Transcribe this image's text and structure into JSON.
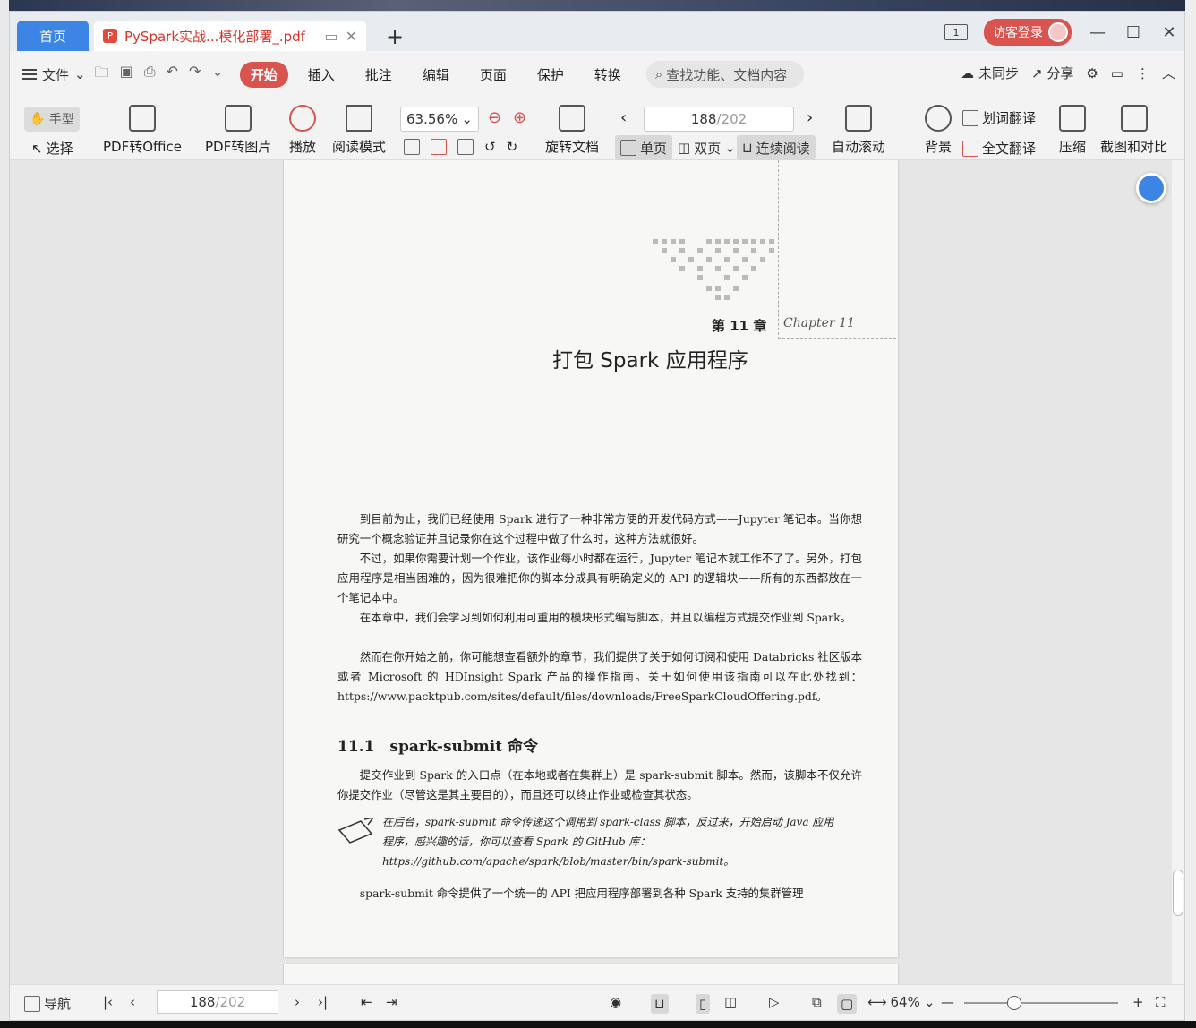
{
  "tabs": {
    "home": "首页",
    "doc": "PySpark实战...模化部署_.pdf"
  },
  "title_right": {
    "page_indicator": "1",
    "login": "访客登录"
  },
  "menu": {
    "file": "文件",
    "tabs": [
      "开始",
      "插入",
      "批注",
      "编辑",
      "页面",
      "保护",
      "转换"
    ],
    "search_placeholder": "查找功能、文档内容",
    "sync": "未同步",
    "share": "分享"
  },
  "ribbon": {
    "hand": "手型",
    "select": "选择",
    "pdf_office": "PDF转Office",
    "pdf_image": "PDF转图片",
    "play": "播放",
    "read_mode": "阅读模式",
    "zoom": "63.56%",
    "rotate": "旋转文档",
    "page_current": "188",
    "page_total": "/202",
    "single": "单页",
    "double": "双页",
    "continuous": "连续阅读",
    "auto_scroll": "自动滚动",
    "background": "背景",
    "word_translate": "划词翻译",
    "full_translate": "全文翻译",
    "compress": "压缩",
    "screenshot": "截图和对比"
  },
  "page": {
    "chapter": "第 11 章",
    "chapter_en": "Chapter 11",
    "title": "打包 Spark 应用程序",
    "p1": "到目前为止，我们已经使用 Spark 进行了一种非常方便的开发代码方式——Jupyter 笔记本。当你想研究一个概念验证并且记录你在这个过程中做了什么时，这种方法就很好。",
    "p2": "不过，如果你需要计划一个作业，该作业每小时都在运行，Jupyter 笔记本就工作不了了。另外，打包应用程序是相当困难的，因为很难把你的脚本分成具有明确定义的 API 的逻辑块——所有的东西都放在一个笔记本中。",
    "p3": "在本章中，我们会学习到如何利用可重用的模块形式编写脚本，并且以编程方式提交作业到 Spark。",
    "p4": "然而在你开始之前，你可能想查看额外的章节，我们提供了关于如何订阅和使用 Databricks 社区版本或者 Microsoft 的 HDInsight Spark 产品的操作指南。关于如何使用该指南可以在此处找到：https://www.packtpub.com/sites/default/files/downloads/FreeSparkCloudOffering.pdf。",
    "section": "11.1　spark-submit 命令",
    "p5": "提交作业到 Spark 的入口点（在本地或者在集群上）是 spark-submit 脚本。然而，该脚本不仅允许你提交作业（尽管这是其主要目的），而且还可以终止作业或检查其状态。",
    "note": "在后台，spark-submit 命令传递这个调用到 spark-class 脚本，反过来，开始启动 Java 应用程序，感兴趣的话，你可以查看 Spark 的 GitHub 库：https://github.com/apache/spark/blob/master/bin/spark-submit。",
    "p6": "spark-submit 命令提供了一个统一的 API 把应用程序部署到各种 Spark 支持的集群管理"
  },
  "status": {
    "nav": "导航",
    "page_current": "188",
    "page_total": "/202",
    "zoom": "64%"
  }
}
